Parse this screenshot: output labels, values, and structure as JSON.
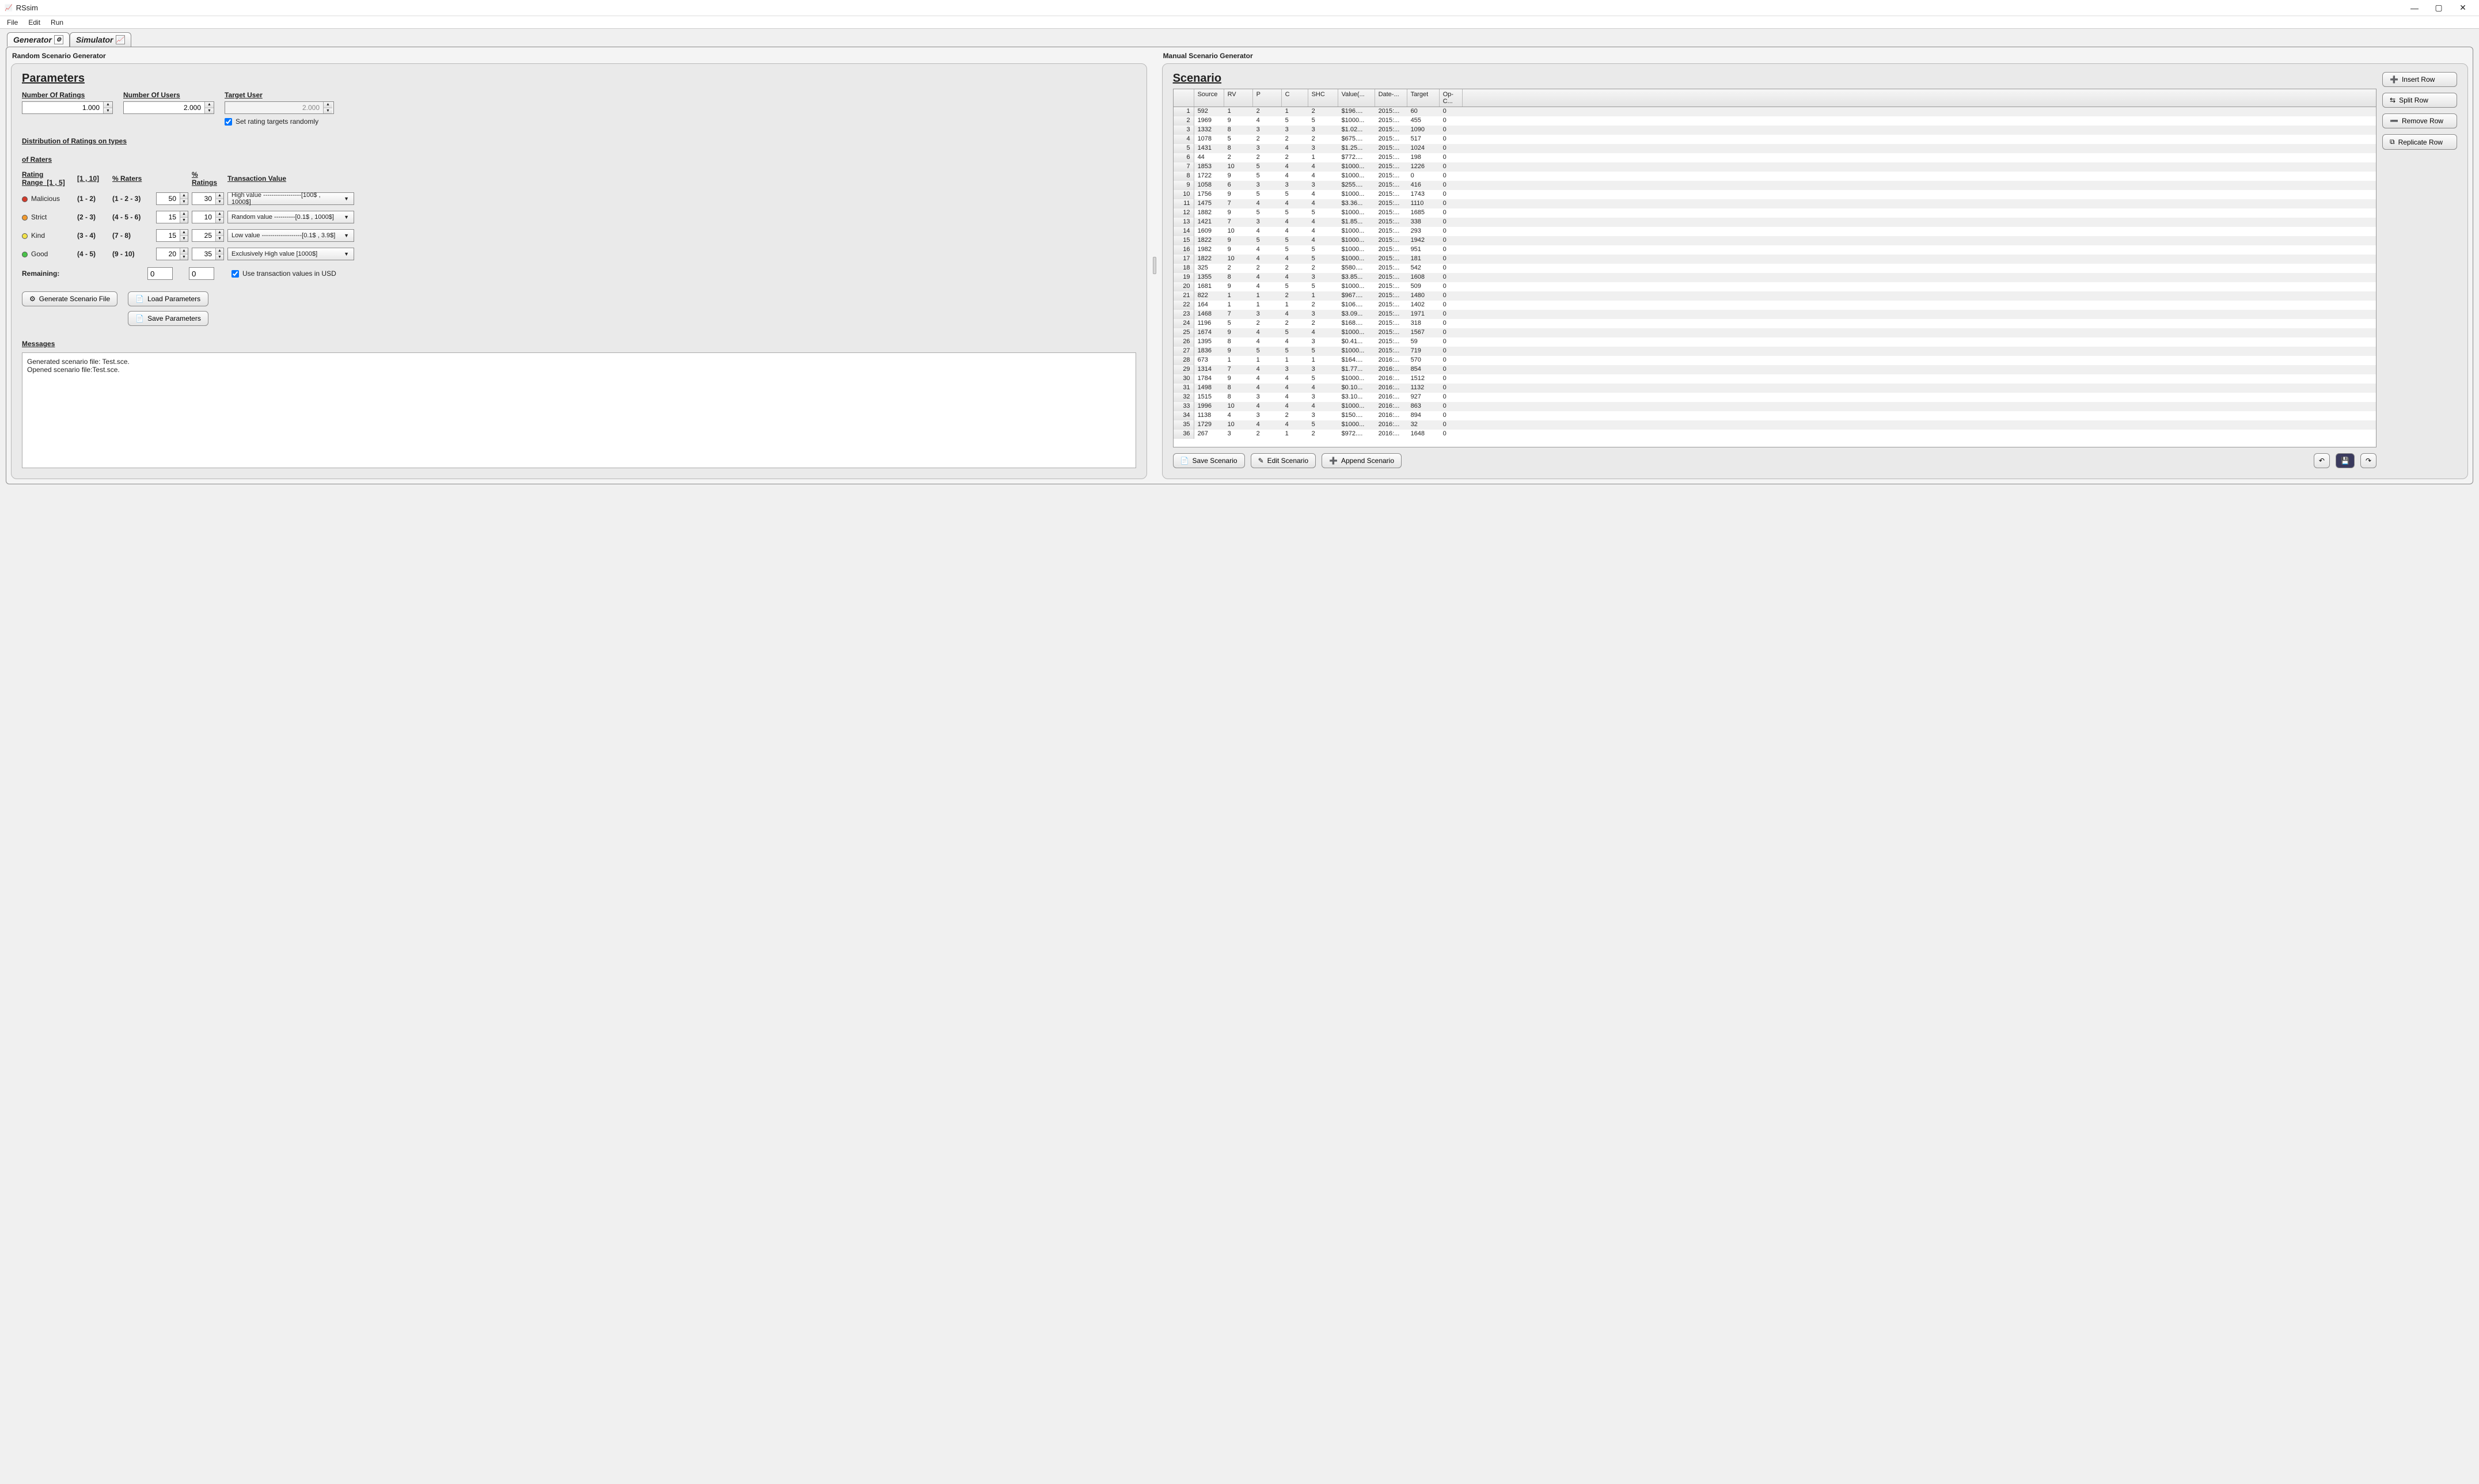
{
  "window": {
    "title": "RSsim",
    "menu": [
      "File",
      "Edit",
      "Run"
    ]
  },
  "tabs": {
    "generator": "Generator",
    "simulator": "Simulator"
  },
  "left": {
    "panel_title": "Random Scenario Generator",
    "params_heading": "Parameters",
    "num_ratings_label": "Number Of Ratings",
    "num_ratings_value": "1.000",
    "num_users_label": "Number Of Users",
    "num_users_value": "2.000",
    "target_user_label": "Target User",
    "target_user_value": "2.000",
    "set_targets_random_label": "Set rating targets randomly",
    "set_targets_random_checked": true,
    "dist_heading_line1": "Distribution of Ratings on types",
    "dist_heading_line2": "of Raters",
    "col_rating_range": "Rating Range",
    "rating_range_1_5": "[1 , 5]",
    "rating_range_1_10": "[1 , 10]",
    "col_pct_raters": "% Raters",
    "col_pct_ratings": "% Ratings",
    "col_txn_value": "Transaction Value",
    "raters": [
      {
        "name": "Malicious",
        "r15": "(1 - 2)",
        "r110": "(1 - 2 - 3)",
        "dot": "#d43a2a",
        "pct_raters": "50",
        "pct_ratings": "30",
        "txn": "High value ------------------[100$ , 1000$]"
      },
      {
        "name": "Strict",
        "r15": "(2 - 3)",
        "r110": "(4 - 5 - 6)",
        "dot": "#f29a2e",
        "pct_raters": "15",
        "pct_ratings": "10",
        "txn": "Random value ----------[0.1$ , 1000$]"
      },
      {
        "name": "Kind",
        "r15": "(3 - 4)",
        "r110": "(7 - 8)",
        "dot": "#f2e24a",
        "pct_raters": "15",
        "pct_ratings": "25",
        "txn": "Low value -------------------[0.1$ , 3.9$]"
      },
      {
        "name": "Good",
        "r15": "(4 - 5)",
        "r110": "(9 - 10)",
        "dot": "#49c349",
        "pct_raters": "20",
        "pct_ratings": "35",
        "txn": "Exclusively High value [1000$]"
      }
    ],
    "remaining_label": "Remaining:",
    "remaining_raters": "0",
    "remaining_ratings": "0",
    "use_usd_label": "Use transaction values in USD",
    "use_usd_checked": true,
    "btn_generate": "Generate Scenario File",
    "btn_load_params": "Load Parameters",
    "btn_save_params": "Save Parameters",
    "messages_label": "Messages",
    "messages_text": "Generated scenario file: Test.sce.\nOpened scenario file:Test.sce."
  },
  "right": {
    "panel_title": "Manual Scenario Generator",
    "heading": "Scenario",
    "columns": [
      "",
      "Source",
      "RV",
      "P",
      "C",
      "SHC",
      "Value(...",
      "Date-...",
      "Target",
      "Op-C..."
    ],
    "rows": [
      {
        "i": 1,
        "src": "592",
        "rv": "1",
        "p": "2",
        "c": "1",
        "shc": "2",
        "val": "$196....",
        "date": "2015:...",
        "tgt": "60",
        "op": "0"
      },
      {
        "i": 2,
        "src": "1969",
        "rv": "9",
        "p": "4",
        "c": "5",
        "shc": "5",
        "val": "$1000...",
        "date": "2015:...",
        "tgt": "455",
        "op": "0"
      },
      {
        "i": 3,
        "src": "1332",
        "rv": "8",
        "p": "3",
        "c": "3",
        "shc": "3",
        "val": "$1.02...",
        "date": "2015:...",
        "tgt": "1090",
        "op": "0"
      },
      {
        "i": 4,
        "src": "1078",
        "rv": "5",
        "p": "2",
        "c": "2",
        "shc": "2",
        "val": "$675....",
        "date": "2015:...",
        "tgt": "517",
        "op": "0"
      },
      {
        "i": 5,
        "src": "1431",
        "rv": "8",
        "p": "3",
        "c": "4",
        "shc": "3",
        "val": "$1.25...",
        "date": "2015:...",
        "tgt": "1024",
        "op": "0"
      },
      {
        "i": 6,
        "src": "44",
        "rv": "2",
        "p": "2",
        "c": "2",
        "shc": "1",
        "val": "$772....",
        "date": "2015:...",
        "tgt": "198",
        "op": "0"
      },
      {
        "i": 7,
        "src": "1853",
        "rv": "10",
        "p": "5",
        "c": "4",
        "shc": "4",
        "val": "$1000...",
        "date": "2015:...",
        "tgt": "1226",
        "op": "0"
      },
      {
        "i": 8,
        "src": "1722",
        "rv": "9",
        "p": "5",
        "c": "4",
        "shc": "4",
        "val": "$1000...",
        "date": "2015:...",
        "tgt": "0",
        "op": "0"
      },
      {
        "i": 9,
        "src": "1058",
        "rv": "6",
        "p": "3",
        "c": "3",
        "shc": "3",
        "val": "$255....",
        "date": "2015:...",
        "tgt": "416",
        "op": "0"
      },
      {
        "i": 10,
        "src": "1756",
        "rv": "9",
        "p": "5",
        "c": "5",
        "shc": "4",
        "val": "$1000...",
        "date": "2015:...",
        "tgt": "1743",
        "op": "0"
      },
      {
        "i": 11,
        "src": "1475",
        "rv": "7",
        "p": "4",
        "c": "4",
        "shc": "4",
        "val": "$3.36...",
        "date": "2015:...",
        "tgt": "1110",
        "op": "0"
      },
      {
        "i": 12,
        "src": "1882",
        "rv": "9",
        "p": "5",
        "c": "5",
        "shc": "5",
        "val": "$1000...",
        "date": "2015:...",
        "tgt": "1685",
        "op": "0"
      },
      {
        "i": 13,
        "src": "1421",
        "rv": "7",
        "p": "3",
        "c": "4",
        "shc": "4",
        "val": "$1.85...",
        "date": "2015:...",
        "tgt": "338",
        "op": "0"
      },
      {
        "i": 14,
        "src": "1609",
        "rv": "10",
        "p": "4",
        "c": "4",
        "shc": "4",
        "val": "$1000...",
        "date": "2015:...",
        "tgt": "293",
        "op": "0"
      },
      {
        "i": 15,
        "src": "1822",
        "rv": "9",
        "p": "5",
        "c": "5",
        "shc": "4",
        "val": "$1000...",
        "date": "2015:...",
        "tgt": "1942",
        "op": "0"
      },
      {
        "i": 16,
        "src": "1982",
        "rv": "9",
        "p": "4",
        "c": "5",
        "shc": "5",
        "val": "$1000...",
        "date": "2015:...",
        "tgt": "951",
        "op": "0"
      },
      {
        "i": 17,
        "src": "1822",
        "rv": "10",
        "p": "4",
        "c": "4",
        "shc": "5",
        "val": "$1000...",
        "date": "2015:...",
        "tgt": "181",
        "op": "0"
      },
      {
        "i": 18,
        "src": "325",
        "rv": "2",
        "p": "2",
        "c": "2",
        "shc": "2",
        "val": "$580....",
        "date": "2015:...",
        "tgt": "542",
        "op": "0"
      },
      {
        "i": 19,
        "src": "1355",
        "rv": "8",
        "p": "4",
        "c": "4",
        "shc": "3",
        "val": "$3.85...",
        "date": "2015:...",
        "tgt": "1608",
        "op": "0"
      },
      {
        "i": 20,
        "src": "1681",
        "rv": "9",
        "p": "4",
        "c": "5",
        "shc": "5",
        "val": "$1000...",
        "date": "2015:...",
        "tgt": "509",
        "op": "0"
      },
      {
        "i": 21,
        "src": "822",
        "rv": "1",
        "p": "1",
        "c": "2",
        "shc": "1",
        "val": "$967....",
        "date": "2015:...",
        "tgt": "1480",
        "op": "0"
      },
      {
        "i": 22,
        "src": "164",
        "rv": "1",
        "p": "1",
        "c": "1",
        "shc": "2",
        "val": "$106....",
        "date": "2015:...",
        "tgt": "1402",
        "op": "0"
      },
      {
        "i": 23,
        "src": "1468",
        "rv": "7",
        "p": "3",
        "c": "4",
        "shc": "3",
        "val": "$3.09...",
        "date": "2015:...",
        "tgt": "1971",
        "op": "0"
      },
      {
        "i": 24,
        "src": "1196",
        "rv": "5",
        "p": "2",
        "c": "2",
        "shc": "2",
        "val": "$168....",
        "date": "2015:...",
        "tgt": "318",
        "op": "0"
      },
      {
        "i": 25,
        "src": "1674",
        "rv": "9",
        "p": "4",
        "c": "5",
        "shc": "4",
        "val": "$1000...",
        "date": "2015:...",
        "tgt": "1567",
        "op": "0"
      },
      {
        "i": 26,
        "src": "1395",
        "rv": "8",
        "p": "4",
        "c": "4",
        "shc": "3",
        "val": "$0.41...",
        "date": "2015:...",
        "tgt": "59",
        "op": "0"
      },
      {
        "i": 27,
        "src": "1836",
        "rv": "9",
        "p": "5",
        "c": "5",
        "shc": "5",
        "val": "$1000...",
        "date": "2015:...",
        "tgt": "719",
        "op": "0"
      },
      {
        "i": 28,
        "src": "673",
        "rv": "1",
        "p": "1",
        "c": "1",
        "shc": "1",
        "val": "$164....",
        "date": "2016:...",
        "tgt": "570",
        "op": "0"
      },
      {
        "i": 29,
        "src": "1314",
        "rv": "7",
        "p": "4",
        "c": "3",
        "shc": "3",
        "val": "$1.77...",
        "date": "2016:...",
        "tgt": "854",
        "op": "0"
      },
      {
        "i": 30,
        "src": "1784",
        "rv": "9",
        "p": "4",
        "c": "4",
        "shc": "5",
        "val": "$1000...",
        "date": "2016:...",
        "tgt": "1512",
        "op": "0"
      },
      {
        "i": 31,
        "src": "1498",
        "rv": "8",
        "p": "4",
        "c": "4",
        "shc": "4",
        "val": "$0.10...",
        "date": "2016:...",
        "tgt": "1132",
        "op": "0"
      },
      {
        "i": 32,
        "src": "1515",
        "rv": "8",
        "p": "3",
        "c": "4",
        "shc": "3",
        "val": "$3.10...",
        "date": "2016:...",
        "tgt": "927",
        "op": "0"
      },
      {
        "i": 33,
        "src": "1996",
        "rv": "10",
        "p": "4",
        "c": "4",
        "shc": "4",
        "val": "$1000...",
        "date": "2016:...",
        "tgt": "863",
        "op": "0"
      },
      {
        "i": 34,
        "src": "1138",
        "rv": "4",
        "p": "3",
        "c": "2",
        "shc": "3",
        "val": "$150....",
        "date": "2016:...",
        "tgt": "894",
        "op": "0"
      },
      {
        "i": 35,
        "src": "1729",
        "rv": "10",
        "p": "4",
        "c": "4",
        "shc": "5",
        "val": "$1000...",
        "date": "2016:...",
        "tgt": "32",
        "op": "0"
      },
      {
        "i": 36,
        "src": "267",
        "rv": "3",
        "p": "2",
        "c": "1",
        "shc": "2",
        "val": "$972....",
        "date": "2016:...",
        "tgt": "1648",
        "op": "0"
      }
    ],
    "btn_insert": "Insert Row",
    "btn_split": "Split Row",
    "btn_remove": "Remove Row",
    "btn_replicate": "Replicate Row",
    "btn_save_scenario": "Save Scenario",
    "btn_edit_scenario": "Edit Scenario",
    "btn_append_scenario": "Append Scenario"
  }
}
